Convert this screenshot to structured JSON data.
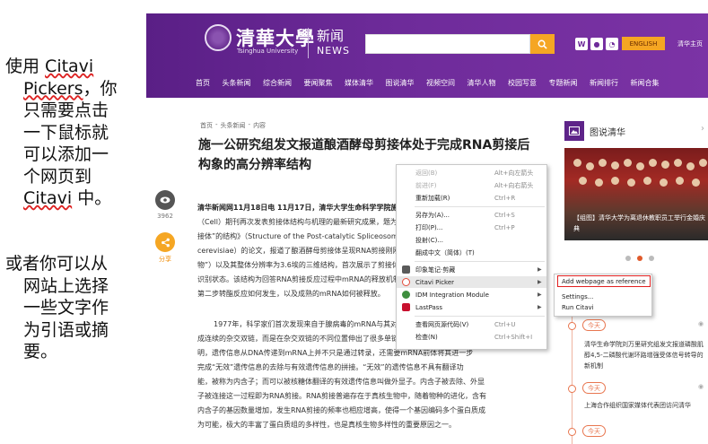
{
  "caption": {
    "block1": {
      "first": "使用 Citavi",
      "rest": [
        "Pickers，你",
        "只需要点击",
        "一下鼠标就",
        "可以添加一",
        "个网页到",
        "Citavi 中。"
      ]
    },
    "block2": {
      "first": "或者你可以从",
      "rest": [
        "网站上选择",
        "一些文字作",
        "为引语或摘",
        "要。"
      ]
    }
  },
  "site": {
    "logo_name": "清華大學",
    "logo_en": "Tsinghua University",
    "news_cn": "新闻",
    "news_en": "NEWS",
    "social_icons": [
      "weibo-icon",
      "wechat-icon",
      "rss-icon"
    ],
    "english_label": "ENGLISH",
    "home_link": "清华主页",
    "accent_purple": "#6e2b9a",
    "accent_orange": "#f5a623"
  },
  "nav": [
    "首页",
    "头条新闻",
    "综合新闻",
    "要闻聚焦",
    "媒体清华",
    "图说清华",
    "视频空间",
    "清华人物",
    "校园写意",
    "专题新闻",
    "新闻排行",
    "新闻合集"
  ],
  "article": {
    "breadcrumb": [
      "首页",
      "-",
      "头条新闻",
      "-",
      "内容"
    ],
    "title": "施一公研究组发文报道酿酒酵母剪接体处于完成RNA剪接后构象的高分辨率结构",
    "views": "3962",
    "share_label": "分享",
    "p1_lines": [
      "清华新闻网11月18日电 11月17日，清华大学生命科学学院施一公研究组在《细胞》",
      "（Cell）期刊再次发表剪接体结构与机理的最新研究成果，题为“处于完成RNA剪接后构象的剪",
      "接体”的结构》（Structure of the Post-catalytic Spliceosome from Saccharomyces",
      "cerevisiae）的论文，报道了酿酒酵母剪接体呈现RNA剪接刚刚完成后构象的高分辨率结构",
      "物”）以及其整体分辨率为3.6埃的三维结构，首次展示了剪接体在完成剪接反应后的状态，",
      "识别状态。该结构为回答RNA剪接反应过程中mRNA的释放机制提供了重要依据，揭示了",
      "第二步转酯反应如何发生，以及成熟的mRNA如何被释放。"
    ],
    "p2_lines": [
      "1977年，科学家们首次发现来自于腺病毒的mRNA与其对应的DNA并非完全对应，",
      "成连续的杂交双链，而是在杂交双链的不同位置伸出了很多单链环，这一现象表明，",
      "明，遗传信息从DNA传递到mRNA上并不只是通过转录，还需要mRNA前体将其进一步",
      "完成“无效”遗传信息的去除与有效遗传信息的拼接。“无效”的遗传信息不具有翻译功",
      "能，被称为内含子；而可以被核糖体翻译的有效遗传信息叫做外显子。内含子被去除、外显",
      "子被连接这一过程即为RNA剪接。RNA剪接普遍存在于真核生物中，随着物种的进化，含有",
      "内含子的基因数量增加，发生RNA剪接的频率也相应增高，使得一个基因编码多个蛋白质成",
      "为可能，极大的丰富了蛋白质组的多样性，也是真核生物多样性的重要原因之一。"
    ]
  },
  "sidebar": {
    "title": "图说清华",
    "more": "›",
    "photo_caption": "【组图】清华大学为离退休教职员工举行金婚庆典",
    "dots_active": 1,
    "timeline": [
      {
        "badge": "今天",
        "text": "清华生命学院刘万里研究组发文报道磷酸肌醇4,5-二磷酸代谢环路增强受体信号转导的新机制"
      },
      {
        "badge": "今天",
        "text": "上海合作组织国家媒体代表团访问清华"
      },
      {
        "badge": "今天",
        "text": ""
      }
    ]
  },
  "context_menu": {
    "items": [
      {
        "label": "返回(B)",
        "shortcut": "Alt+向左箭头",
        "disabled": true
      },
      {
        "label": "前进(F)",
        "shortcut": "Alt+向右箭头",
        "disabled": true
      },
      {
        "label": "重新加载(R)",
        "shortcut": "Ctrl+R",
        "disabled": false
      },
      {
        "label": "另存为(A)...",
        "shortcut": "Ctrl+S",
        "disabled": false
      },
      {
        "label": "打印(P)...",
        "shortcut": "Ctrl+P",
        "disabled": false
      },
      {
        "label": "投射(C)...",
        "shortcut": "",
        "disabled": false
      },
      {
        "label": "翻成中文（简体）(T)",
        "shortcut": "",
        "disabled": false
      },
      {
        "label": "印象笔记·剪藏",
        "shortcut": "",
        "disabled": false,
        "icon": "evernote-icon",
        "icon_color": "#5a5a5a",
        "submenu": true
      },
      {
        "label": "Citavi Picker",
        "shortcut": "",
        "disabled": false,
        "icon": "citavi-icon",
        "icon_color": "#e34b3a",
        "submenu": true,
        "hover": true
      },
      {
        "label": "IDM Integration Module",
        "shortcut": "",
        "disabled": false,
        "icon": "idm-icon",
        "icon_color": "#3e8e3e",
        "submenu": true
      },
      {
        "label": "LastPass",
        "shortcut": "",
        "disabled": false,
        "icon": "lastpass-icon",
        "icon_color": "#c8102e",
        "submenu": true
      },
      {
        "label": "查看网页源代码(V)",
        "shortcut": "Ctrl+U",
        "disabled": false
      },
      {
        "label": "检查(N)",
        "shortcut": "Ctrl+Shift+I",
        "disabled": false
      }
    ],
    "submenu": {
      "items": [
        "Add webpage as reference",
        "Settings...",
        "Run Citavi"
      ],
      "highlight_color": "#e02020"
    }
  }
}
